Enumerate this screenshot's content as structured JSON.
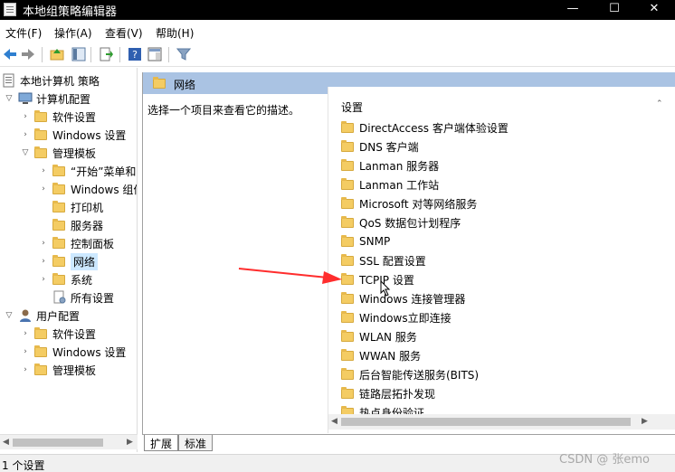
{
  "window": {
    "title": "本地组策略编辑器",
    "controls": {
      "minimize": "—",
      "maximize": "☐",
      "close": "✕"
    }
  },
  "menu": {
    "items": [
      "文件(F)",
      "操作(A)",
      "查看(V)",
      "帮助(H)"
    ]
  },
  "toolbar": {
    "icons": [
      "back-arrow",
      "forward-arrow",
      "up-folder",
      "show-hide-tree",
      "export-list",
      "help",
      "show-hide-pane",
      "filter"
    ]
  },
  "tree": {
    "items": [
      {
        "label": "本地计算机 策略"
      },
      {
        "label": "计算机配置"
      },
      {
        "label": "软件设置"
      },
      {
        "label": "Windows 设置"
      },
      {
        "label": "管理模板"
      },
      {
        "label": "“开始”菜单和"
      },
      {
        "label": "Windows 组件"
      },
      {
        "label": "打印机"
      },
      {
        "label": "服务器"
      },
      {
        "label": "控制面板"
      },
      {
        "label": "网络",
        "selected": true
      },
      {
        "label": "系统"
      },
      {
        "label": "所有设置"
      },
      {
        "label": "用户配置"
      },
      {
        "label": "软件设置"
      },
      {
        "label": "Windows 设置"
      },
      {
        "label": "管理模板"
      }
    ]
  },
  "content": {
    "header_title": "网络",
    "description": "选择一个项目来查看它的描述。",
    "column_header": "设置",
    "items": [
      "DirectAccess 客户端体验设置",
      "DNS 客户端",
      "Lanman 服务器",
      "Lanman 工作站",
      "Microsoft 对等网络服务",
      "QoS 数据包计划程序",
      "SNMP",
      "SSL 配置设置",
      "TCPIP 设置",
      "Windows 连接管理器",
      "Windows立即连接",
      "WLAN 服务",
      "WWAN 服务",
      "后台智能传送服务(BITS)",
      "链路层拓扑发现",
      "热点身份验证"
    ]
  },
  "tabs": [
    "扩展",
    "标准"
  ],
  "status": {
    "text": "1 个设置"
  },
  "watermark": "CSDN @ 张emo",
  "colors": {
    "header_bg": "#aac3e3",
    "selection": "#cce8ff",
    "annotation_arrow": "#ff2d2d",
    "folder": "#f4cc63"
  }
}
